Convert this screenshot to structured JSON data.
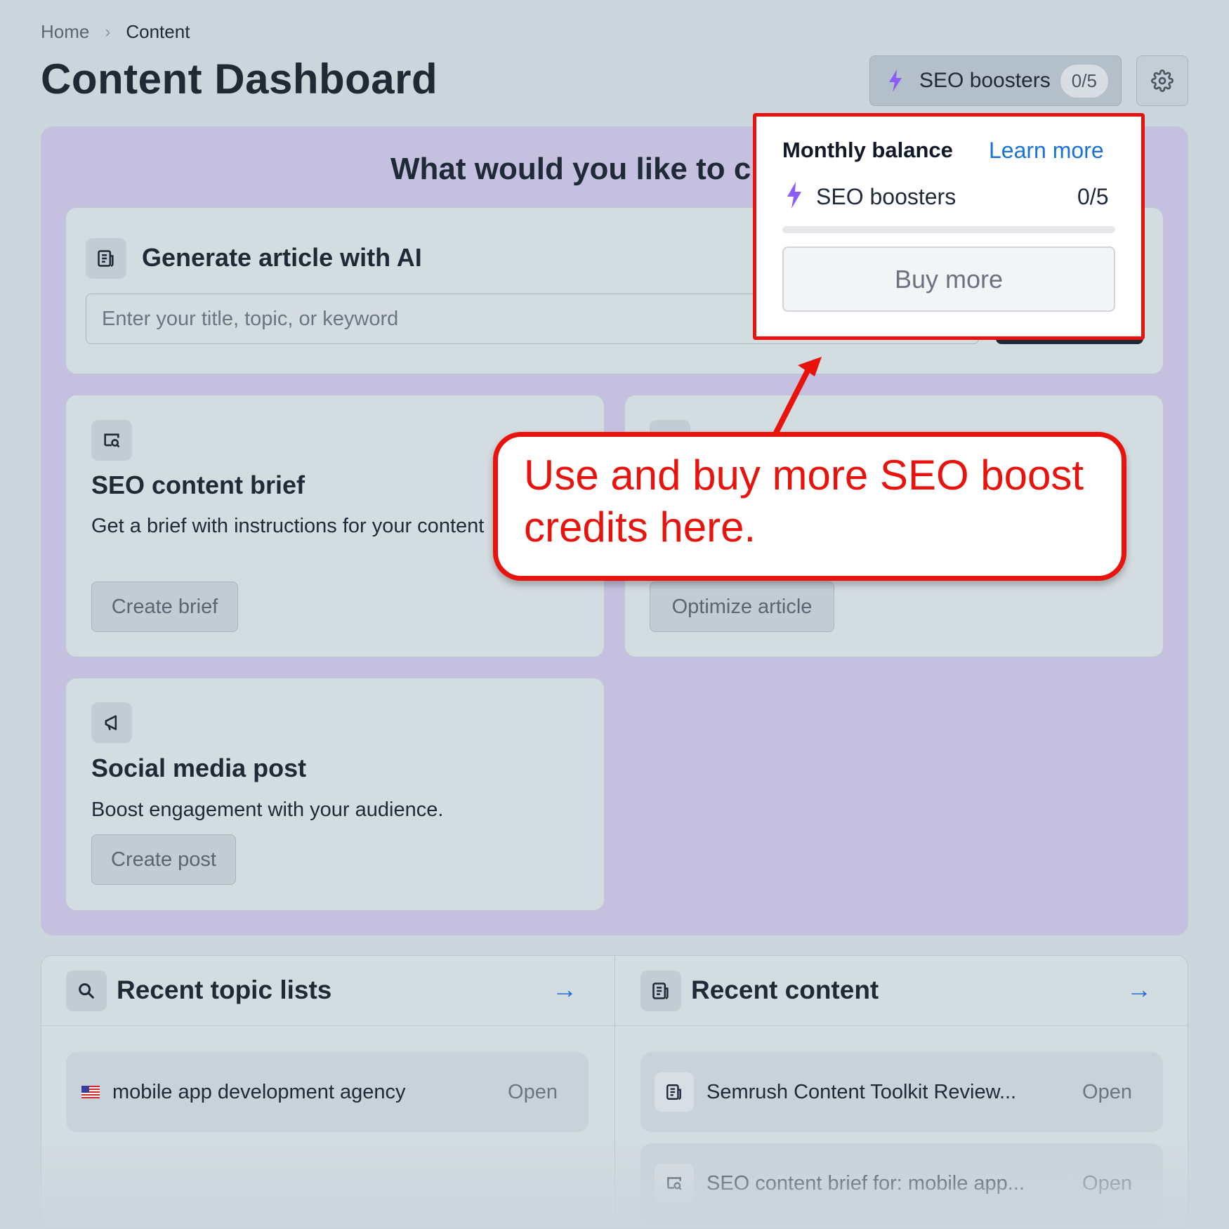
{
  "breadcrumb": {
    "home": "Home",
    "separator": "›",
    "current": "Content"
  },
  "page_title": "Content Dashboard",
  "header": {
    "boosters_label": "SEO boosters",
    "boosters_count": "0/5"
  },
  "hero": {
    "question": "What would you like to create?",
    "generate": {
      "title": "Generate article with AI",
      "input_placeholder": "Enter your title, topic, or keyword"
    },
    "cards": {
      "brief": {
        "title": "SEO content brief",
        "desc": "Get a brief with instructions for your content",
        "button": "Create brief"
      },
      "optimize": {
        "button": "Optimize article"
      },
      "social": {
        "title": "Social media post",
        "desc": "Boost engagement with your audience.",
        "button": "Create post"
      }
    }
  },
  "recent_topics": {
    "title": "Recent topic lists",
    "items": [
      {
        "label": "mobile app development agency",
        "action": "Open"
      }
    ]
  },
  "recent_content": {
    "title": "Recent content",
    "items": [
      {
        "label": "Semrush Content Toolkit Review...",
        "action": "Open"
      },
      {
        "label": "SEO content brief for: mobile app...",
        "action": "Open"
      }
    ]
  },
  "popover": {
    "title": "Monthly balance",
    "learn_more": "Learn more",
    "boosters_label": "SEO boosters",
    "boosters_count": "0/5",
    "progress_fraction": 0,
    "buy_button": "Buy more"
  },
  "annotation": {
    "text": "Use and buy more SEO boost credits here."
  },
  "colors": {
    "accent_blue": "#1a73d6",
    "annotation_red": "#e8130d",
    "bolt_purple": "#8b5cf6",
    "hero_purple": "#c5c0df"
  }
}
